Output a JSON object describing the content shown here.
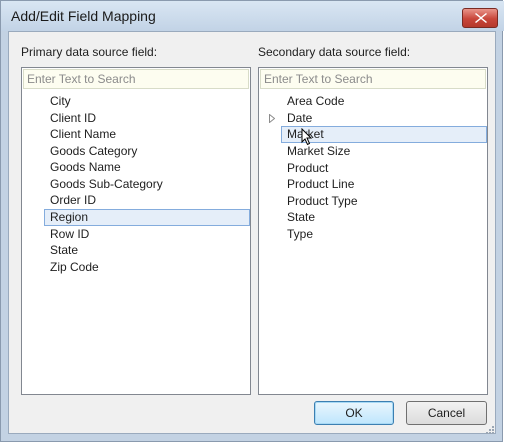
{
  "window": {
    "title": "Add/Edit Field Mapping"
  },
  "primary": {
    "label": "Primary data source field:",
    "search_placeholder": "Enter Text to Search",
    "items": [
      "City",
      "Client ID",
      "Client Name",
      "Goods Category",
      "Goods Name",
      "Goods Sub-Category",
      "Order ID",
      "Region",
      "Row ID",
      "State",
      "Zip Code"
    ],
    "selected": "Region"
  },
  "secondary": {
    "label": "Secondary data source field:",
    "search_placeholder": "Enter Text to Search",
    "items": [
      "Area Code",
      "Date",
      "Market",
      "Market Size",
      "Product",
      "Product Line",
      "Product Type",
      "State",
      "Type"
    ],
    "selected": "Market",
    "expandable": "Date"
  },
  "buttons": {
    "ok": "OK",
    "cancel": "Cancel"
  },
  "icons": {
    "close": "close-icon",
    "expander": "triangle-right-icon",
    "grip": "resize-grip-icon",
    "cursor": "mouse-pointer-icon"
  },
  "colors": {
    "selection_bg": "#e5eef9",
    "selection_border": "#84acdd",
    "close_red": "#c8463a",
    "search_bg": "#fdfdf0"
  }
}
